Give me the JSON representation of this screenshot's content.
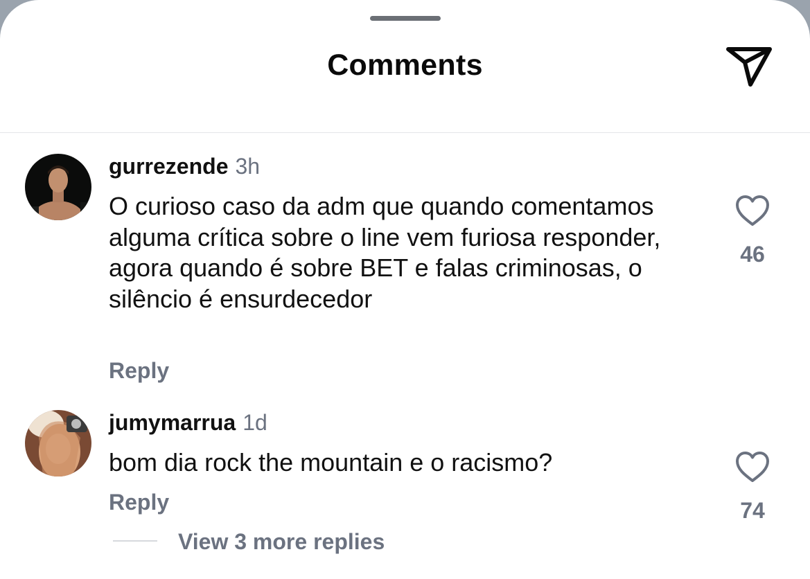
{
  "header": {
    "title": "Comments",
    "share_icon": "paper-plane-icon"
  },
  "comments": [
    {
      "username": "gurrezende",
      "time": "3h",
      "text": "O curioso caso da adm que quando comentamos alguma crítica sobre o line vem furiosa responder, agora quando é sobre BET e falas criminosas, o silêncio é ensurdecedor",
      "reply_label": "Reply",
      "likes": "46",
      "like_icon": "heart-outline-icon"
    },
    {
      "username": "jumymarrua",
      "time": "1d",
      "text": "bom dia rock the mountain e o racismo?",
      "reply_label": "Reply",
      "likes": "74",
      "like_icon": "heart-outline-icon",
      "view_replies_label": "View 3 more replies"
    }
  ],
  "colors": {
    "text_primary": "#111111",
    "text_secondary": "#6b7280",
    "background": "#ffffff"
  }
}
